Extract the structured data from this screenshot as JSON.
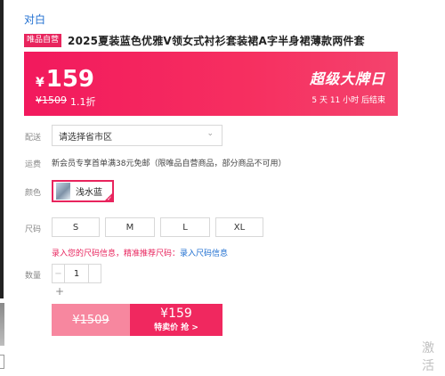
{
  "brand": "对白",
  "product": {
    "badge": "唯品自营",
    "title": "2025夏装蓝色优雅V领女式衬衫套装裙A字半身裙薄款两件套"
  },
  "price": {
    "currency": "¥",
    "current": "159",
    "original": "¥1509",
    "discount": "1.1折",
    "promo_title": "超级大牌日",
    "countdown": "5 天 11 小时 后结束"
  },
  "delivery": {
    "label": "配送",
    "placeholder": "请选择省市区",
    "chevron_icon": "chevron-down-icon"
  },
  "shipping": {
    "label": "运费",
    "text": "新会员专享首单满38元免邮（限唯品自营商品，部分商品不可用）"
  },
  "color": {
    "label": "颜色",
    "selected": "浅水蓝"
  },
  "size": {
    "label": "尺码",
    "options": [
      "S",
      "M",
      "L",
      "XL"
    ],
    "hint_text": "录入您的尺码信息，精准推荐尺码：",
    "hint_link": "录入尺码信息"
  },
  "quantity": {
    "label": "数量",
    "minus": "−",
    "value": "1",
    "plus": "+"
  },
  "buy": {
    "original_price": "¥1509",
    "now_price": "¥159",
    "now_label": "特卖价 抢 >"
  },
  "watermark": {
    "line1": "激活",
    "line2": "转到"
  },
  "colors": {
    "accent": "#f0285f",
    "badge": "#e8245d",
    "link": "#1f6fd1"
  }
}
